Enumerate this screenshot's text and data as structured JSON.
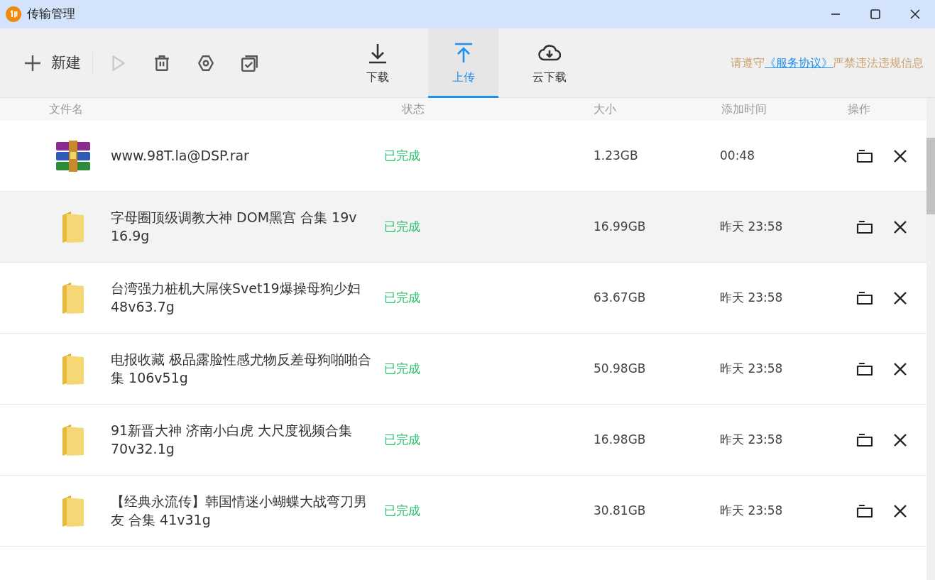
{
  "window": {
    "title": "传输管理"
  },
  "toolbar": {
    "new_label": "新建",
    "buttons": [
      {
        "kind": "play",
        "disabled": true
      },
      {
        "kind": "delete",
        "disabled": false
      },
      {
        "kind": "settings",
        "disabled": false
      },
      {
        "kind": "select",
        "disabled": false
      }
    ]
  },
  "tabs": [
    {
      "kind": "download",
      "label": "下载",
      "selected": false
    },
    {
      "kind": "upload",
      "label": "上传",
      "selected": true
    },
    {
      "kind": "cloud",
      "label": "云下载",
      "selected": false
    }
  ],
  "notice": {
    "before": "请遵守",
    "link": "《服务协议》",
    "after": "严禁违法违规信息"
  },
  "table": {
    "columns": [
      "文件名",
      "状态",
      "大小",
      "添加时间",
      "操作"
    ],
    "rows": [
      {
        "kind": "archive",
        "name": "www.98T.la@DSP.rar",
        "status": "已完成",
        "size": "1.23GB",
        "time": "00:48",
        "highlighted": false
      },
      {
        "kind": "folder",
        "name": "字母圈顶级调教大神 DOM黑宫 合集 19v 16.9g",
        "status": "已完成",
        "size": "16.99GB",
        "time": "昨天 23:58",
        "highlighted": true
      },
      {
        "kind": "folder",
        "name": "台湾强力桩机大屌侠Svet19爆操母狗少妇 48v63.7g",
        "status": "已完成",
        "size": "63.67GB",
        "time": "昨天 23:58",
        "highlighted": false
      },
      {
        "kind": "folder",
        "name": "电报收藏 极品露脸性感尤物反差母狗啪啪合集 106v51g",
        "status": "已完成",
        "size": "50.98GB",
        "time": "昨天 23:58",
        "highlighted": false
      },
      {
        "kind": "folder",
        "name": "91新晋大神 济南小白虎 大尺度视频合集 70v32.1g",
        "status": "已完成",
        "size": "16.98GB",
        "time": "昨天 23:58",
        "highlighted": false
      },
      {
        "kind": "folder",
        "name": "【经典永流传】韩国情迷小蝴蝶大战弯刀男友 合集 41v31g",
        "status": "已完成",
        "size": "30.81GB",
        "time": "昨天 23:58",
        "highlighted": false
      }
    ]
  }
}
